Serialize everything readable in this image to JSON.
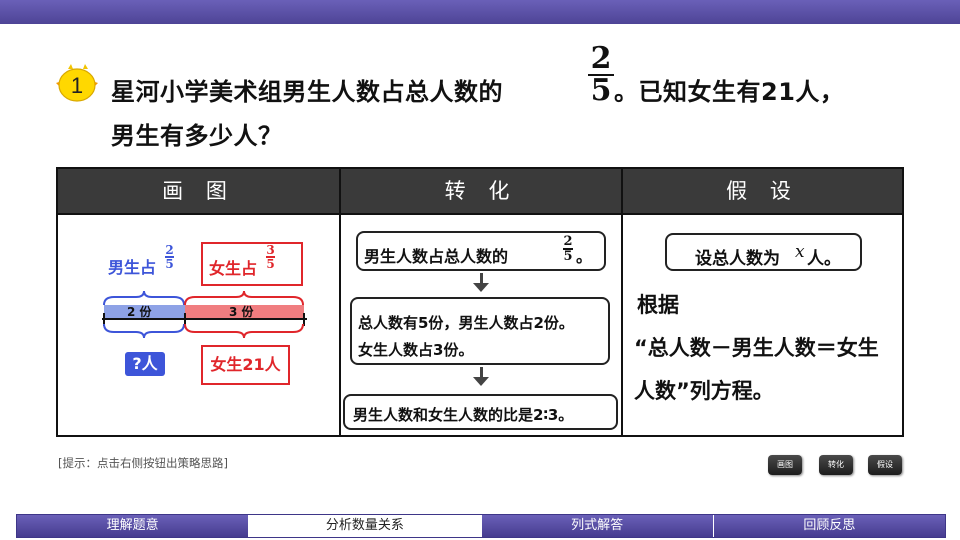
{
  "question": {
    "number": "1",
    "line1_a": "星河小学美术组男生人数占总人数的",
    "frac_num": "2",
    "frac_den": "5",
    "line1_b": "。已知女生有21人，",
    "line2": "男生有多少人？"
  },
  "table": {
    "headers": [
      "画 图",
      "转 化",
      "假 设"
    ],
    "draw": {
      "boy_label": "男生占",
      "boy_num": "2",
      "boy_den": "5",
      "girl_label": "女生占",
      "girl_num": "3",
      "girl_den": "5",
      "boy_parts": "2 份",
      "girl_parts": "3 份",
      "unknown": "?人",
      "girl_count": "女生21人",
      "boy_color": "#3d55d9",
      "girl_color": "#e0262b"
    },
    "transform": {
      "step1": "男生人数占总人数的",
      "step1_num": "2",
      "step1_den": "5",
      "step1_end": "。",
      "step2_line1": "总人数有5份，男生人数占2份。",
      "step2_line2": "女生人数占3份。",
      "step3": "男生人数和女生人数的比是2∶3。"
    },
    "assume": {
      "box_a": "设总人数为",
      "box_var": "x",
      "box_b": "人。",
      "line1": "根据",
      "line2": "“总人数－男生人数＝女生",
      "line3": "人数”列方程。"
    }
  },
  "hint": "[提示：点击右侧按钮出策略思路]",
  "buttons": [
    "画图",
    "转化",
    "假设"
  ],
  "nav": {
    "tabs": [
      "理解题意",
      "分析数量关系",
      "列式解答",
      "回顾反思"
    ],
    "active_index": 1
  }
}
